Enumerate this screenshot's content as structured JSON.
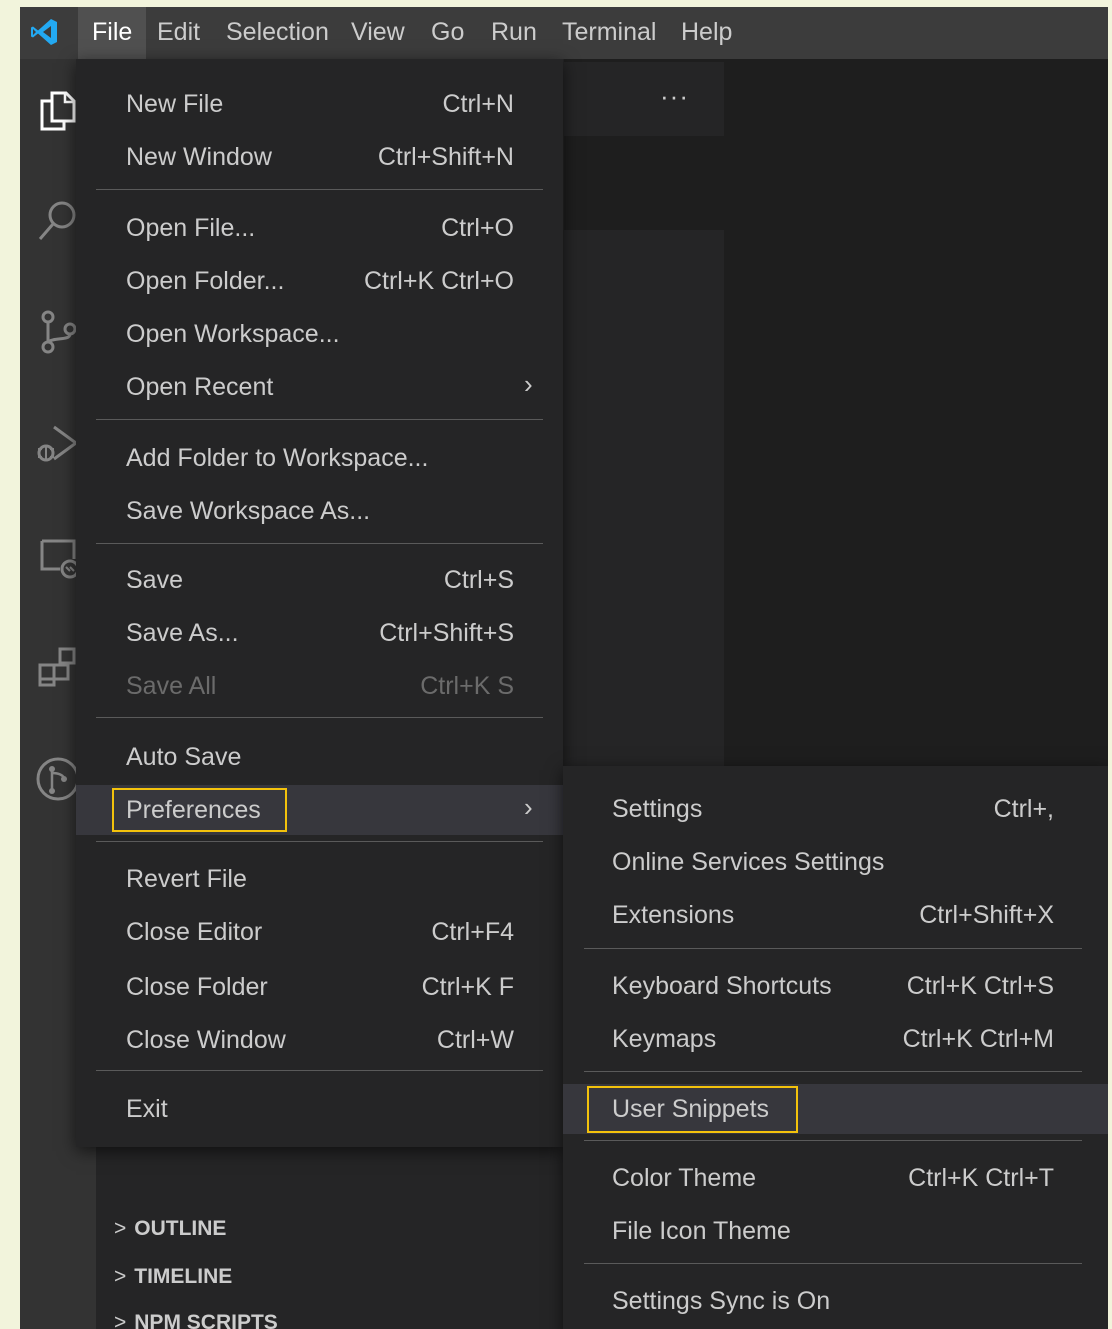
{
  "menubar": {
    "items": [
      "File",
      "Edit",
      "Selection",
      "View",
      "Go",
      "Run",
      "Terminal",
      "Help"
    ]
  },
  "sidebar": {
    "more_label": "···",
    "sections": [
      "OUTLINE",
      "TIMELINE",
      "NPM SCRIPTS"
    ]
  },
  "file_menu": {
    "items": [
      {
        "label": "New File",
        "shortcut": "Ctrl+N"
      },
      {
        "label": "New Window",
        "shortcut": "Ctrl+Shift+N"
      },
      {
        "label": "Open File...",
        "shortcut": "Ctrl+O"
      },
      {
        "label": "Open Folder...",
        "shortcut": "Ctrl+K Ctrl+O"
      },
      {
        "label": "Open Workspace...",
        "shortcut": ""
      },
      {
        "label": "Open Recent",
        "shortcut": "",
        "submenu_arrow": "›"
      },
      {
        "label": "Add Folder to Workspace...",
        "shortcut": ""
      },
      {
        "label": "Save Workspace As...",
        "shortcut": ""
      },
      {
        "label": "Save",
        "shortcut": "Ctrl+S"
      },
      {
        "label": "Save As...",
        "shortcut": "Ctrl+Shift+S"
      },
      {
        "label": "Save All",
        "shortcut": "Ctrl+K S",
        "disabled": true
      },
      {
        "label": "Auto Save",
        "shortcut": ""
      },
      {
        "label": "Preferences",
        "shortcut": "",
        "submenu_arrow": "›"
      },
      {
        "label": "Revert File",
        "shortcut": ""
      },
      {
        "label": "Close Editor",
        "shortcut": "Ctrl+F4"
      },
      {
        "label": "Close Folder",
        "shortcut": "Ctrl+K F"
      },
      {
        "label": "Close Window",
        "shortcut": "Ctrl+W"
      },
      {
        "label": "Exit",
        "shortcut": ""
      }
    ]
  },
  "preferences_menu": {
    "items": [
      {
        "label": "Settings",
        "shortcut": "Ctrl+,"
      },
      {
        "label": "Online Services Settings",
        "shortcut": ""
      },
      {
        "label": "Extensions",
        "shortcut": "Ctrl+Shift+X"
      },
      {
        "label": "Keyboard Shortcuts",
        "shortcut": "Ctrl+K Ctrl+S"
      },
      {
        "label": "Keymaps",
        "shortcut": "Ctrl+K Ctrl+M"
      },
      {
        "label": "User Snippets",
        "shortcut": ""
      },
      {
        "label": "Color Theme",
        "shortcut": "Ctrl+K Ctrl+T"
      },
      {
        "label": "File Icon Theme",
        "shortcut": ""
      },
      {
        "label": "Settings Sync is On",
        "shortcut": ""
      }
    ]
  },
  "colors": {
    "highlight_box": "#f3c20c",
    "vscode_blue": "#0078d4",
    "menu_bg": "#252526"
  },
  "icons": [
    "vscode-logo-icon",
    "explorer-icon",
    "search-icon",
    "source-control-icon",
    "run-debug-icon",
    "remote-explorer-icon",
    "extensions-icon",
    "gitlens-icon"
  ]
}
